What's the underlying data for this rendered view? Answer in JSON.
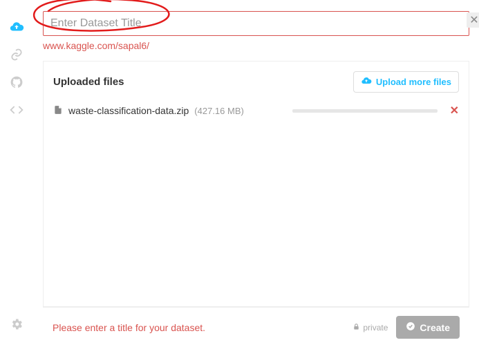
{
  "sidebar": {
    "items": [
      {
        "name": "upload-cloud-icon",
        "active": true
      },
      {
        "name": "link-icon",
        "active": false
      },
      {
        "name": "github-icon",
        "active": false
      },
      {
        "name": "code-icon",
        "active": false
      }
    ],
    "settings_name": "gear-icon"
  },
  "title_field": {
    "placeholder": "Enter Dataset Title",
    "value": ""
  },
  "dataset_url": "www.kaggle.com/sapal6/",
  "panel": {
    "header": "Uploaded files",
    "upload_more_label": "Upload more files"
  },
  "files": [
    {
      "name": "waste-classification-data.zip",
      "size": "(427.16 MB)"
    }
  ],
  "footer": {
    "error": "Please enter a title for your dataset.",
    "private_label": "private",
    "create_label": "Create"
  }
}
